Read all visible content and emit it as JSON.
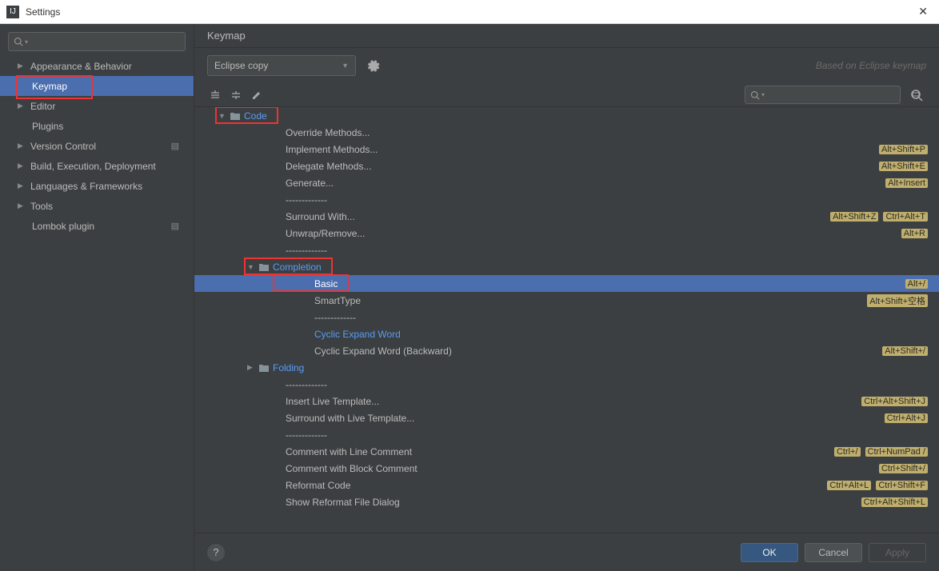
{
  "window": {
    "title": "Settings"
  },
  "sidebar": {
    "search_placeholder": "",
    "items": [
      {
        "label": "Appearance & Behavior",
        "expandable": true,
        "level": 1
      },
      {
        "label": "Keymap",
        "expandable": false,
        "level": 2,
        "selected": true,
        "highlight": true
      },
      {
        "label": "Editor",
        "expandable": true,
        "level": 1
      },
      {
        "label": "Plugins",
        "expandable": false,
        "level": 2
      },
      {
        "label": "Version Control",
        "expandable": true,
        "level": 1,
        "proj": true
      },
      {
        "label": "Build, Execution, Deployment",
        "expandable": true,
        "level": 1
      },
      {
        "label": "Languages & Frameworks",
        "expandable": true,
        "level": 1
      },
      {
        "label": "Tools",
        "expandable": true,
        "level": 1
      },
      {
        "label": "Lombok plugin",
        "expandable": false,
        "level": 2,
        "proj": true
      }
    ]
  },
  "main": {
    "title": "Keymap",
    "scheme": "Eclipse copy",
    "based_on": "Based on Eclipse keymap",
    "actions": [
      {
        "type": "group",
        "label": "Code",
        "indent": 1,
        "expanded": true,
        "highlight": true
      },
      {
        "type": "action",
        "label": "Override Methods...",
        "indent": 2
      },
      {
        "type": "action",
        "label": "Implement Methods...",
        "indent": 2,
        "shortcuts": [
          "Alt+Shift+P"
        ]
      },
      {
        "type": "action",
        "label": "Delegate Methods...",
        "indent": 2,
        "shortcuts": [
          "Alt+Shift+E"
        ]
      },
      {
        "type": "action",
        "label": "Generate...",
        "indent": 2,
        "shortcuts": [
          "Alt+Insert"
        ]
      },
      {
        "type": "sep",
        "label": "-------------",
        "indent": 2
      },
      {
        "type": "action",
        "label": "Surround With...",
        "indent": 2,
        "shortcuts": [
          "Alt+Shift+Z",
          "Ctrl+Alt+T"
        ]
      },
      {
        "type": "action",
        "label": "Unwrap/Remove...",
        "indent": 2,
        "shortcuts": [
          "Alt+R"
        ]
      },
      {
        "type": "sep",
        "label": "-------------",
        "indent": 2
      },
      {
        "type": "group",
        "label": "Completion",
        "indent": 2,
        "expanded": true,
        "highlight": true
      },
      {
        "type": "action",
        "label": "Basic",
        "indent": 3,
        "selected": true,
        "highlight": true,
        "shortcuts": [
          "Alt+/"
        ]
      },
      {
        "type": "action",
        "label": "SmartType",
        "indent": 3,
        "shortcuts": [
          "Alt+Shift+空格"
        ]
      },
      {
        "type": "sep",
        "label": "-------------",
        "indent": 3
      },
      {
        "type": "action",
        "label": "Cyclic Expand Word",
        "indent": 3,
        "blue": true
      },
      {
        "type": "action",
        "label": "Cyclic Expand Word (Backward)",
        "indent": 3,
        "shortcuts": [
          "Alt+Shift+/"
        ]
      },
      {
        "type": "group",
        "label": "Folding",
        "indent": 2,
        "expanded": false
      },
      {
        "type": "sep",
        "label": "-------------",
        "indent": 2
      },
      {
        "type": "action",
        "label": "Insert Live Template...",
        "indent": 2,
        "shortcuts": [
          "Ctrl+Alt+Shift+J"
        ]
      },
      {
        "type": "action",
        "label": "Surround with Live Template...",
        "indent": 2,
        "shortcuts": [
          "Ctrl+Alt+J"
        ]
      },
      {
        "type": "sep",
        "label": "-------------",
        "indent": 2
      },
      {
        "type": "action",
        "label": "Comment with Line Comment",
        "indent": 2,
        "shortcuts": [
          "Ctrl+/",
          "Ctrl+NumPad /"
        ]
      },
      {
        "type": "action",
        "label": "Comment with Block Comment",
        "indent": 2,
        "shortcuts": [
          "Ctrl+Shift+/"
        ]
      },
      {
        "type": "action",
        "label": "Reformat Code",
        "indent": 2,
        "shortcuts": [
          "Ctrl+Alt+L",
          "Ctrl+Shift+F"
        ]
      },
      {
        "type": "action",
        "label": "Show Reformat File Dialog",
        "indent": 2,
        "shortcuts": [
          "Ctrl+Alt+Shift+L"
        ]
      }
    ]
  },
  "footer": {
    "ok": "OK",
    "cancel": "Cancel",
    "apply": "Apply"
  }
}
